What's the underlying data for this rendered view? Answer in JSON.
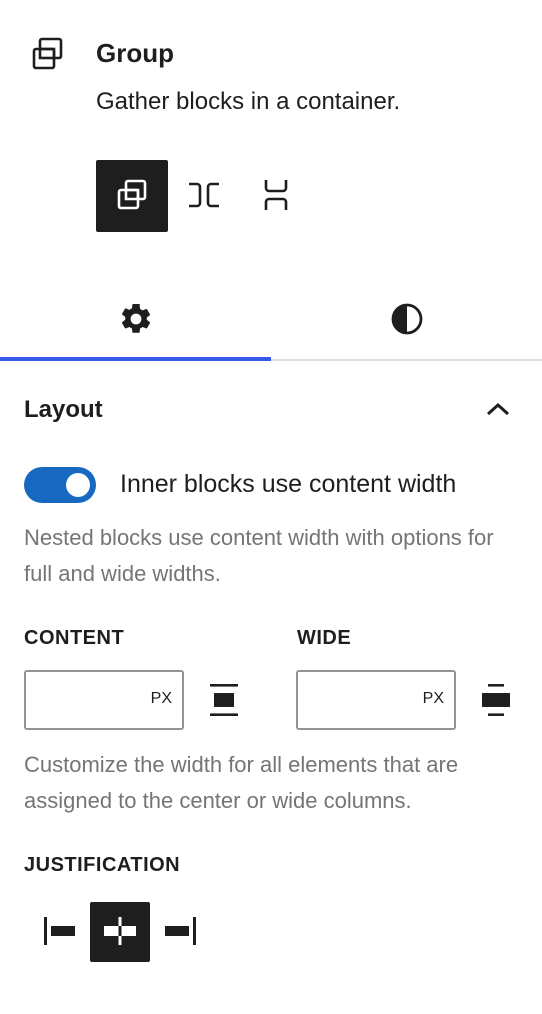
{
  "block": {
    "title": "Group",
    "description": "Gather blocks in a container.",
    "icon": "group-icon"
  },
  "variations": [
    {
      "name": "group",
      "icon": "group-icon",
      "active": true
    },
    {
      "name": "row",
      "icon": "row-icon",
      "active": false
    },
    {
      "name": "stack",
      "icon": "stack-icon",
      "active": false
    }
  ],
  "tabs": [
    {
      "name": "settings",
      "icon": "gear-icon",
      "active": true
    },
    {
      "name": "styles",
      "icon": "half-circle-icon",
      "active": false
    }
  ],
  "layout_panel": {
    "title": "Layout",
    "expanded": true,
    "toggle_label": "Inner blocks use content width",
    "toggle_on": true,
    "toggle_help": "Nested blocks use content width with options for full and wide widths.",
    "content_label": "CONTENT",
    "content_value": "",
    "content_unit": "PX",
    "wide_label": "WIDE",
    "wide_value": "",
    "wide_unit": "PX",
    "width_help": "Customize the width for all elements that are assigned to the center or wide columns.",
    "justification_label": "JUSTIFICATION",
    "justification_selected": "center"
  },
  "colors": {
    "accent": "#3858e9",
    "toggle": "#1668c0",
    "dark": "#1e1e1e",
    "muted": "#757575"
  }
}
